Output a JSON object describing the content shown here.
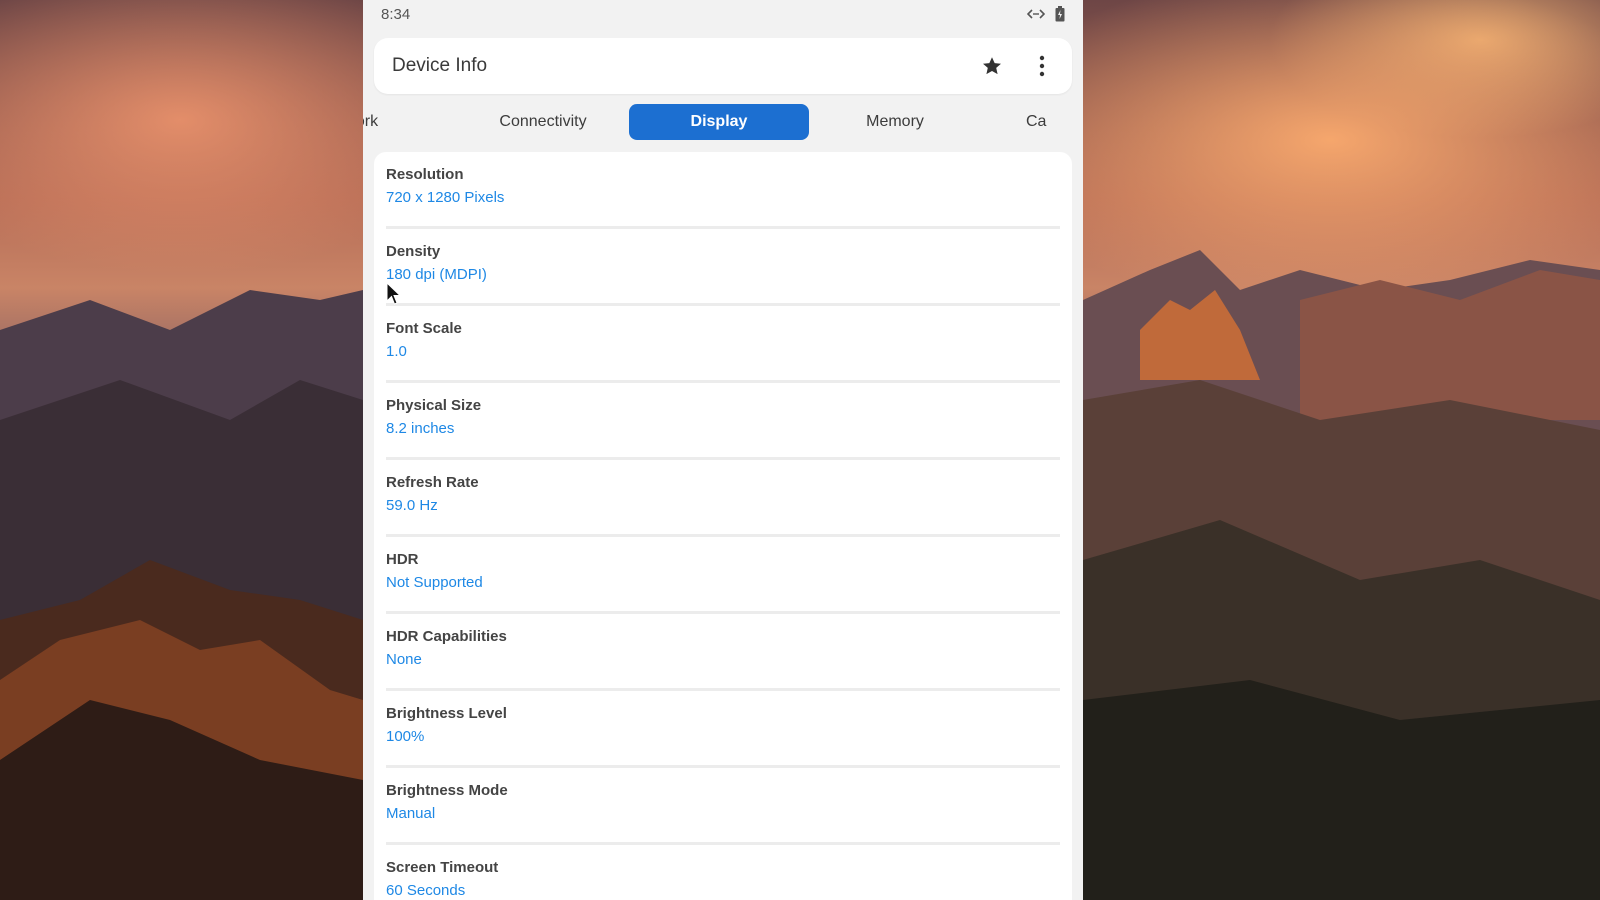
{
  "status_bar": {
    "time": "8:34"
  },
  "app_bar": {
    "title": "Device Info"
  },
  "tabs": [
    {
      "label": "ork"
    },
    {
      "label": "Connectivity"
    },
    {
      "label": "Display",
      "active": true
    },
    {
      "label": "Memory"
    },
    {
      "label": "Ca"
    }
  ],
  "items": [
    {
      "label": "Resolution",
      "value": "720 x 1280 Pixels"
    },
    {
      "label": "Density",
      "value": "180 dpi (MDPI)"
    },
    {
      "label": "Font Scale",
      "value": "1.0"
    },
    {
      "label": "Physical Size",
      "value": "8.2 inches"
    },
    {
      "label": "Refresh Rate",
      "value": "59.0 Hz"
    },
    {
      "label": "HDR",
      "value": "Not Supported"
    },
    {
      "label": "HDR Capabilities",
      "value": "None"
    },
    {
      "label": "Brightness Level",
      "value": "100%"
    },
    {
      "label": "Brightness Mode",
      "value": "Manual"
    },
    {
      "label": "Screen Timeout",
      "value": "60 Seconds"
    }
  ],
  "icons": {
    "status": [
      "link-arrows-icon",
      "battery-icon"
    ],
    "app_bar": [
      "star-icon",
      "more-vert-icon"
    ]
  },
  "colors": {
    "accent": "#1c6fd1",
    "value_text": "#1e88e5",
    "background": "#f2f2f2"
  }
}
